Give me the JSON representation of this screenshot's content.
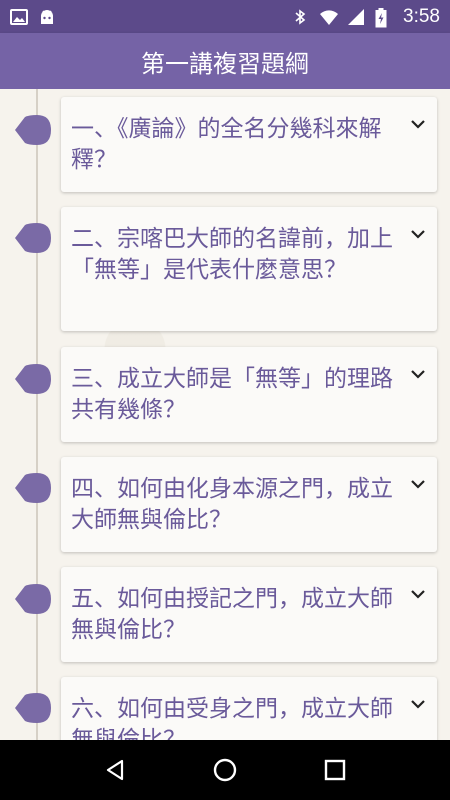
{
  "status_bar": {
    "time": "3:58",
    "icons": [
      "image-icon",
      "android-icon",
      "bluetooth-icon",
      "wifi-icon",
      "signal-icon",
      "battery-charging-icon"
    ]
  },
  "app_bar": {
    "title": "第一講複習題綱"
  },
  "items": [
    {
      "text": "一、《廣論》的全名分幾科來解釋？"
    },
    {
      "text": "二、宗喀巴大師的名諱前，加上「無等」是代表什麼意思？"
    },
    {
      "text": "三、成立大師是「無等」的理路共有幾條？"
    },
    {
      "text": "四、如何由化身本源之門，成立大師無與倫比？"
    },
    {
      "text": "五、如何由授記之門，成立大師無與倫比？"
    },
    {
      "text": "六、如何由受身之門，成立大師無與倫比？"
    }
  ],
  "colors": {
    "status_bar": "#5c4a8a",
    "app_bar": "#7563a6",
    "accent": "#6a5a9a",
    "dot": "#7a6aa6"
  },
  "nav_bar": {
    "buttons": [
      "back-icon",
      "home-icon",
      "recents-icon"
    ]
  }
}
